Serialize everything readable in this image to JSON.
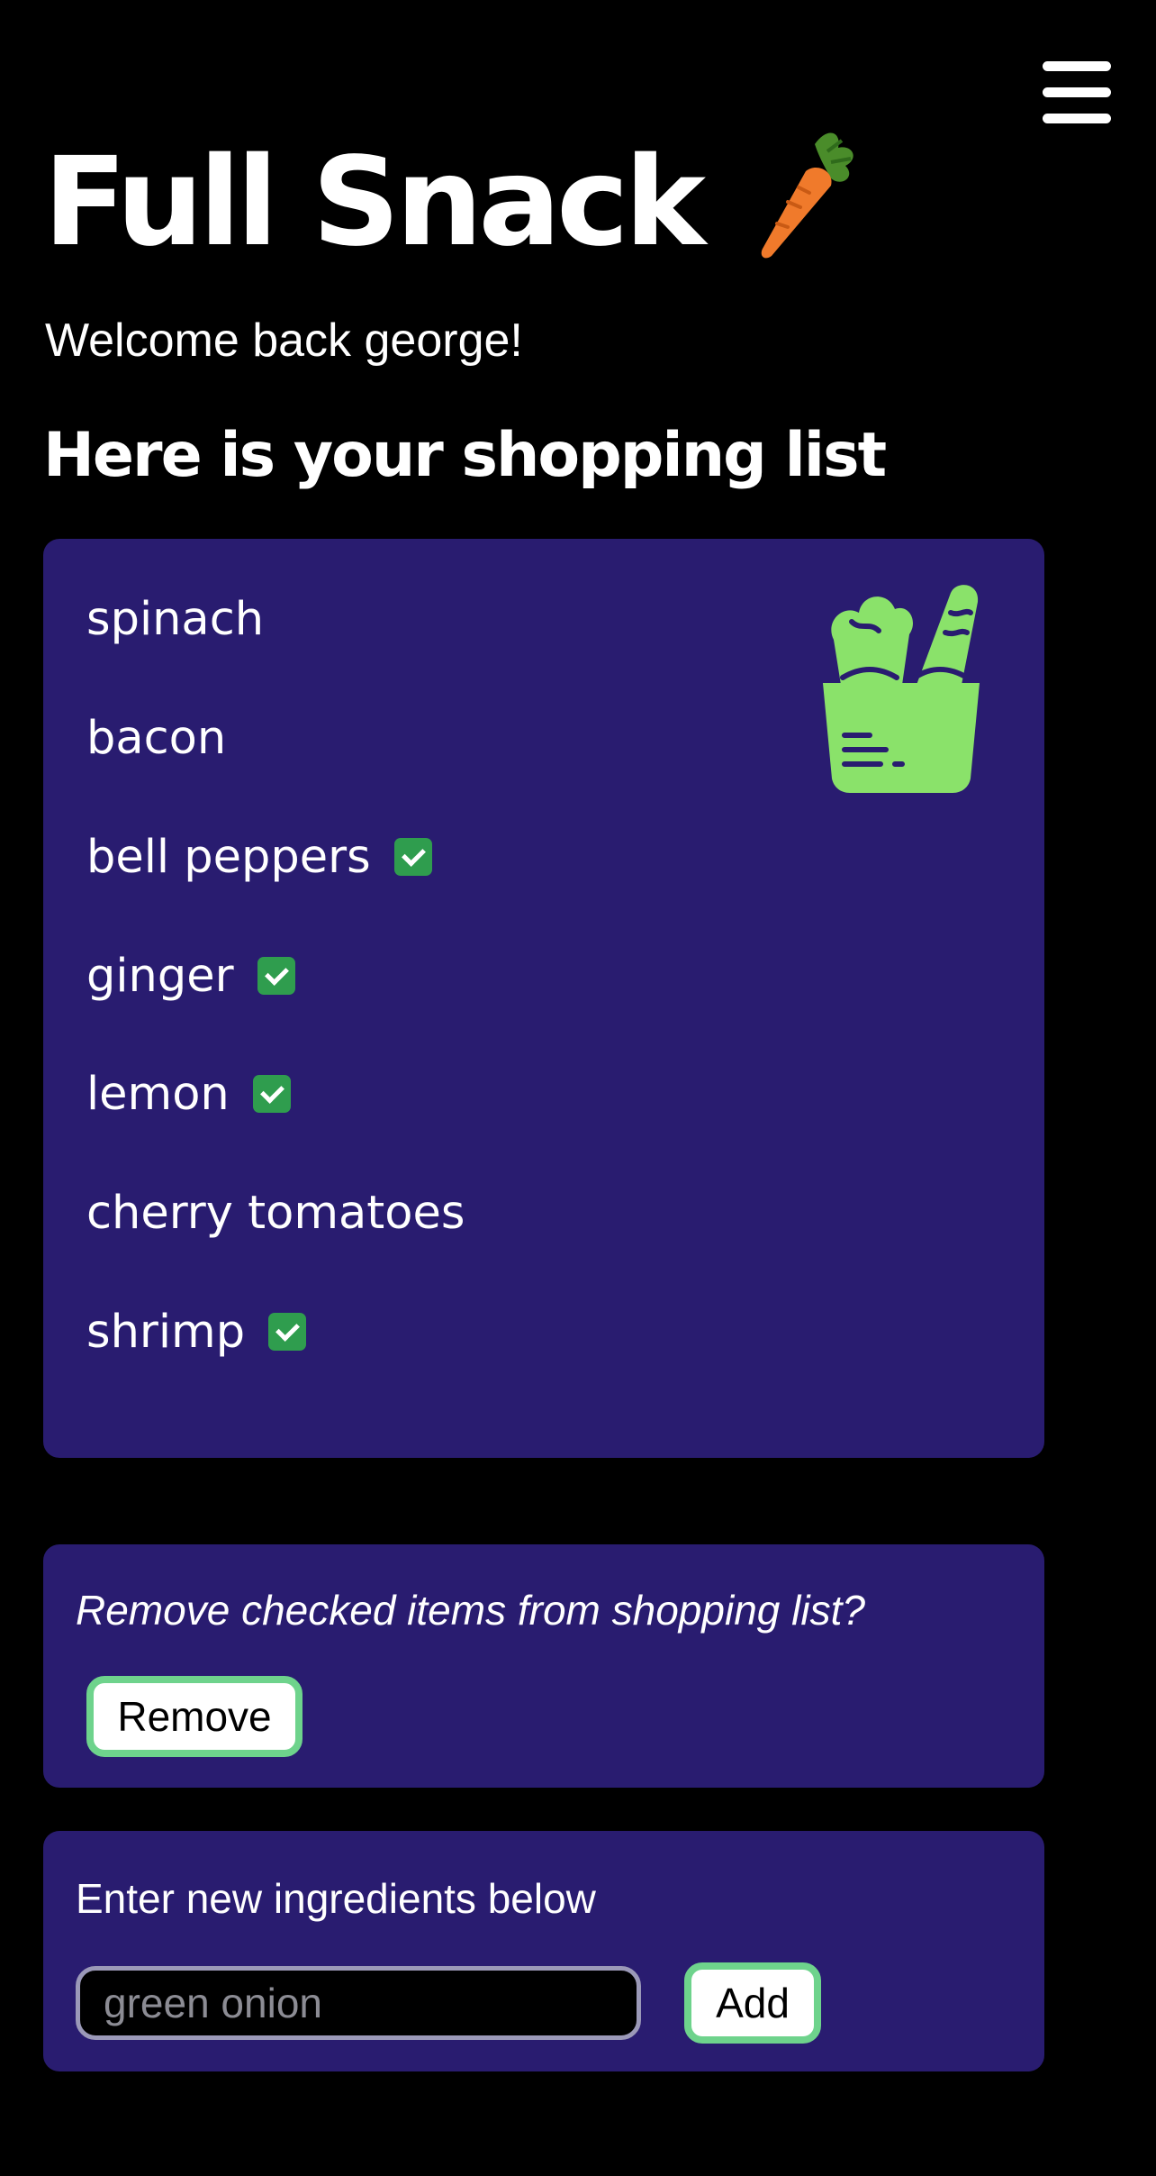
{
  "app": {
    "title": "Full Snack",
    "title_icon": "carrot-icon",
    "menu_icon": "hamburger-menu-icon",
    "welcome": "Welcome back george!"
  },
  "shopping_list": {
    "heading": "Here is your shopping list",
    "illustration_icon": "grocery-bag-icon",
    "items": [
      {
        "label": "spinach",
        "checked": false
      },
      {
        "label": "bacon",
        "checked": false
      },
      {
        "label": "bell peppers",
        "checked": true
      },
      {
        "label": "ginger",
        "checked": true
      },
      {
        "label": "lemon",
        "checked": true
      },
      {
        "label": "cherry tomatoes",
        "checked": false
      },
      {
        "label": "shrimp",
        "checked": true
      }
    ]
  },
  "remove_section": {
    "prompt": "Remove checked items from shopping list?",
    "button_label": "Remove"
  },
  "add_section": {
    "prompt": "Enter new ingredients below",
    "input_placeholder": "green onion",
    "input_value": "",
    "button_label": "Add"
  },
  "colors": {
    "background": "#000000",
    "card": "#291c70",
    "accent_green": "#6ed38c",
    "checkbox_green": "#2f9d4e",
    "illustration_green": "#8ae26a"
  }
}
